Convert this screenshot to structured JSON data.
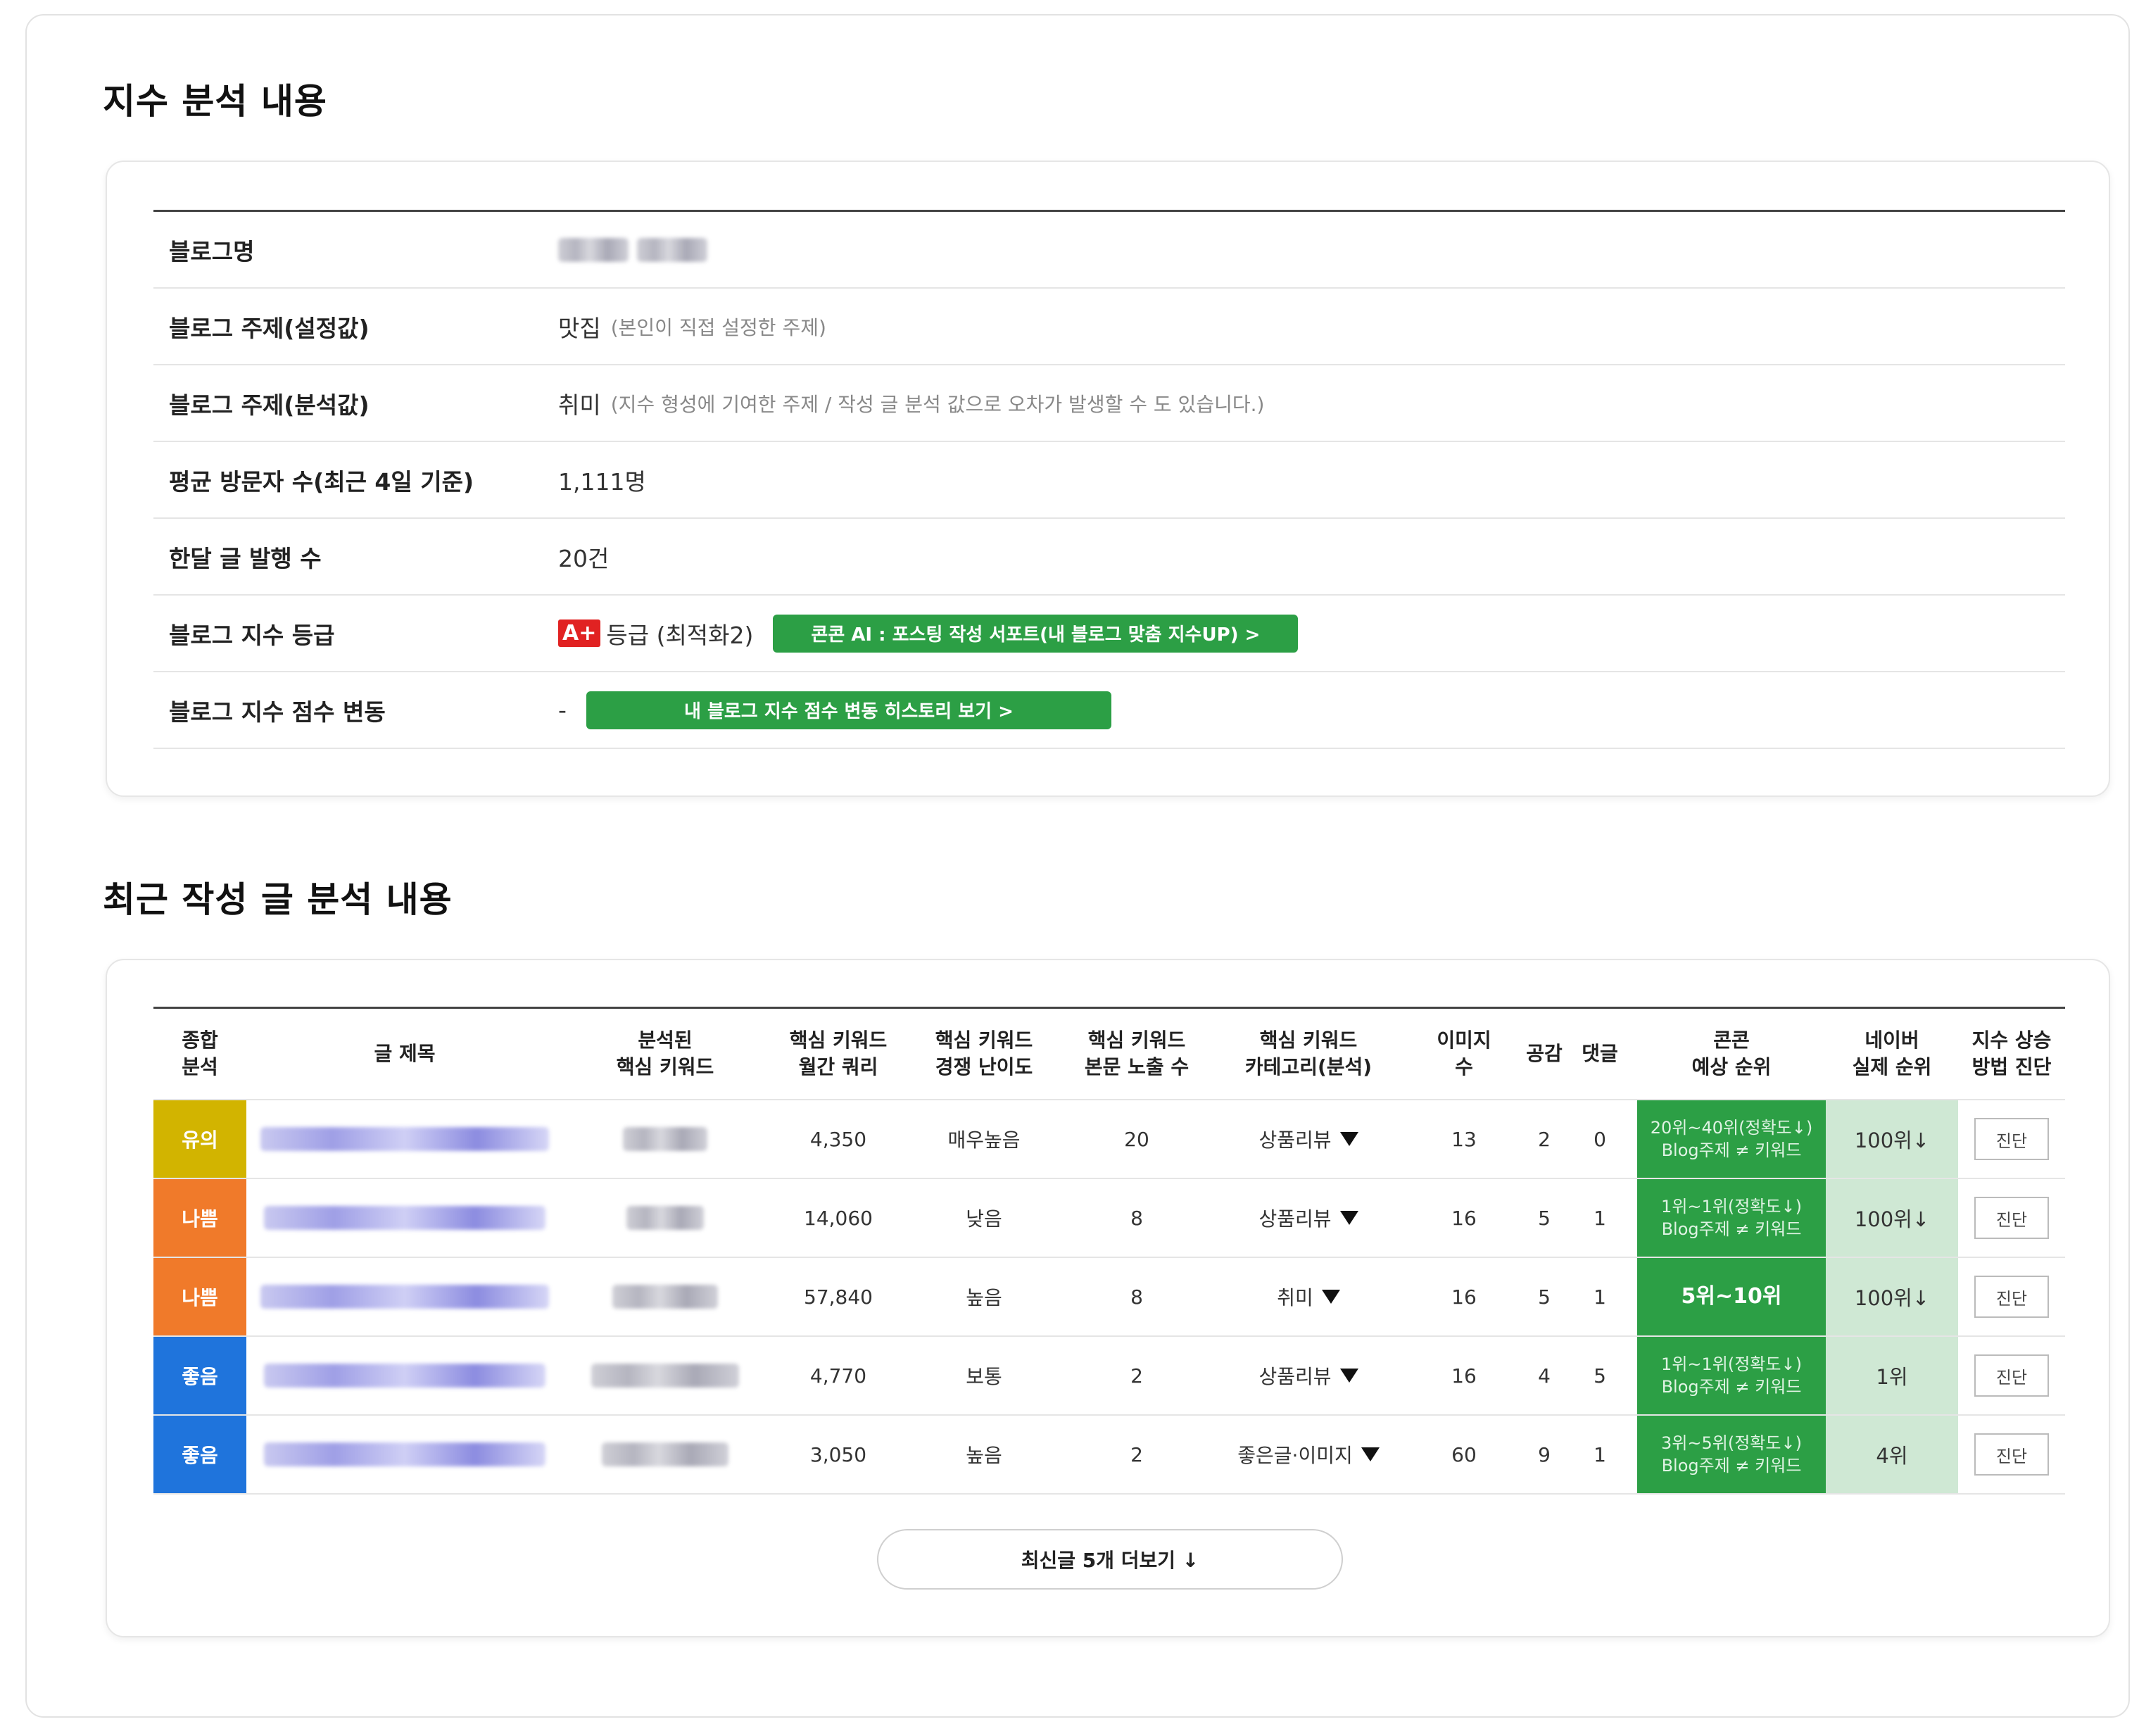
{
  "section1": {
    "title": "지수 분석 내용",
    "rows": [
      {
        "label": "블로그명",
        "value": ""
      },
      {
        "label": "블로그 주제(설정값)",
        "value": "맛집",
        "note": "(본인이 직접 설정한 주제)"
      },
      {
        "label": "블로그 주제(분석값)",
        "value": "취미",
        "note": "(지수 형성에 기여한 주제 / 작성 글 분석 값으로 오차가 발생할 수 도 있습니다.)"
      },
      {
        "label": "평균 방문자 수(최근 4일 기준)",
        "value": "1,111명"
      },
      {
        "label": "한달 글 발행 수",
        "value": "20건"
      },
      {
        "label": "블로그 지수 등급",
        "grade": "A+",
        "value": "등급 (최적화2)",
        "button": "콘콘 AI : 포스팅 작성 서포트(내 블로그 맞춤 지수UP) >"
      },
      {
        "label": "블로그 지수 점수 변동",
        "value": "-",
        "button": "내 블로그 지수 점수 변동 히스토리 보기 >"
      }
    ]
  },
  "section2": {
    "title": "최근 작성 글 분석 내용",
    "headers": [
      "종합\n분석",
      "글 제목",
      "분석된\n핵심 키워드",
      "핵심 키워드\n월간 쿼리",
      "핵심 키워드\n경쟁 난이도",
      "핵심 키워드\n본문 노출 수",
      "핵심 키워드\n카테고리(분석)",
      "이미지\n수",
      "공감",
      "댓글",
      "콘콘\n예상 순위",
      "네이버\n실제 순위",
      "지수 상승\n방법 진단"
    ],
    "rows": [
      {
        "verdict": "유의",
        "verdict_color": "#d2b400",
        "query": "4,350",
        "difficulty": "매우높음",
        "exposure": "20",
        "category": "상품리뷰",
        "images": "13",
        "likes": "2",
        "comments": "0",
        "rank_line1": "20위~40위(정확도↓)",
        "rank_line2": "Blog주제 ≠ 키워드",
        "naver": "100위↓",
        "diag": "진단"
      },
      {
        "verdict": "나쁨",
        "verdict_color": "#f07a2a",
        "query": "14,060",
        "difficulty": "낮음",
        "exposure": "8",
        "category": "상품리뷰",
        "images": "16",
        "likes": "5",
        "comments": "1",
        "rank_line1": "1위~1위(정확도↓)",
        "rank_line2": "Blog주제 ≠ 키워드",
        "naver": "100위↓",
        "diag": "진단"
      },
      {
        "verdict": "나쁨",
        "verdict_color": "#f07a2a",
        "query": "57,840",
        "difficulty": "높음",
        "exposure": "8",
        "category": "취미",
        "images": "16",
        "likes": "5",
        "comments": "1",
        "rank_line1": "5위~10위",
        "rank_line2": "",
        "naver": "100위↓",
        "diag": "진단"
      },
      {
        "verdict": "좋음",
        "verdict_color": "#1f74dc",
        "query": "4,770",
        "difficulty": "보통",
        "exposure": "2",
        "category": "상품리뷰",
        "images": "16",
        "likes": "4",
        "comments": "5",
        "rank_line1": "1위~1위(정확도↓)",
        "rank_line2": "Blog주제 ≠ 키워드",
        "naver": "1위",
        "diag": "진단"
      },
      {
        "verdict": "좋음",
        "verdict_color": "#1f74dc",
        "query": "3,050",
        "difficulty": "높음",
        "exposure": "2",
        "category": "좋은글·이미지",
        "images": "60",
        "likes": "9",
        "comments": "1",
        "rank_line1": "3위~5위(정확도↓)",
        "rank_line2": "Blog주제 ≠ 키워드",
        "naver": "4위",
        "diag": "진단"
      }
    ],
    "more_button": "최신글 5개 더보기 ↓"
  }
}
